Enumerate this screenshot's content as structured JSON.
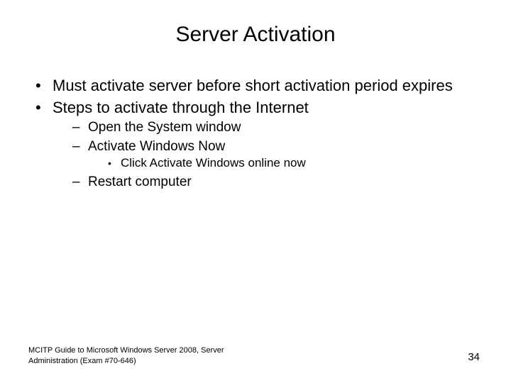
{
  "title": "Server Activation",
  "bullets": {
    "b1": "Must activate server before short activation period expires",
    "b2": "Steps to activate through the Internet",
    "b2_1": "Open the System window",
    "b2_2": "Activate Windows Now",
    "b2_2_1": "Click Activate Windows online now",
    "b2_3": "Restart computer"
  },
  "footer": {
    "left": "MCITP Guide to Microsoft Windows Server 2008, Server Administration (Exam #70-646)",
    "page": "34"
  }
}
